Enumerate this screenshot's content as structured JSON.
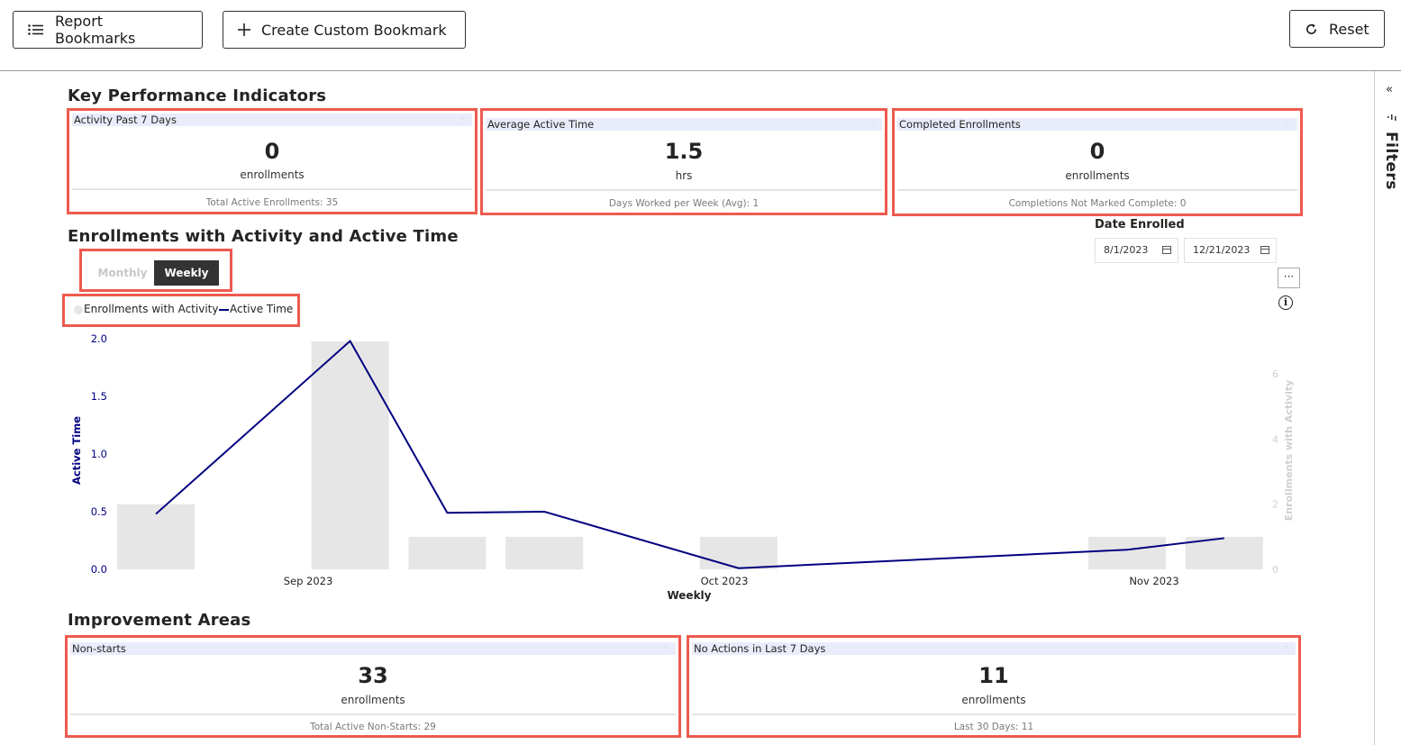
{
  "toolbar": {
    "report_bookmarks": "Report Bookmarks",
    "create_bookmark": "Create Custom Bookmark",
    "reset": "Reset"
  },
  "side_panel": {
    "label": "Filters"
  },
  "kpi_section": {
    "title": "Key Performance Indicators",
    "cards": [
      {
        "title": "Activity Past 7 Days",
        "value": "0",
        "unit": "enrollments",
        "footer": "Total Active Enrollments: 35"
      },
      {
        "title": "Average Active Time",
        "value": "1.5",
        "unit": "hrs",
        "footer": "Days Worked per Week (Avg): 1"
      },
      {
        "title": "Completed Enrollments",
        "value": "0",
        "unit": "enrollments",
        "footer": "Completions Not Marked Complete: 0"
      }
    ]
  },
  "activity_section": {
    "title": "Enrollments with Activity and Active Time",
    "toggle": {
      "options": [
        "Monthly",
        "Weekly"
      ],
      "selected": "Weekly"
    },
    "date_filter": {
      "label": "Date Enrolled",
      "start": "8/1/2023",
      "end": "12/21/2023"
    },
    "more_label": "···",
    "info_label": "i"
  },
  "colors": {
    "accent_highlight": "#ee5a4f",
    "line": "#000080",
    "bar": "#e6e6e6",
    "dark_toggle": "#333333"
  },
  "chart_data": {
    "type": "bar+line",
    "xlabel": "Weekly",
    "x_tick_labels": [
      "Sep 2023",
      "Oct 2023",
      "Nov 2023"
    ],
    "y_left": {
      "label": "Active Time",
      "ticks": [
        "0.0",
        "0.5",
        "1.0",
        "1.5",
        "2.0"
      ],
      "range": [
        0,
        2.0
      ]
    },
    "y_right": {
      "label": "Enrollments with Activity",
      "ticks": [
        "0",
        "2",
        "4",
        "6"
      ],
      "range": [
        0,
        7
      ]
    },
    "legend": {
      "placement": "top-left",
      "entries": [
        "Enrollments with Activity",
        "Active Time"
      ]
    },
    "weeks": [
      {
        "bar": 2,
        "line": 0.48
      },
      {
        "bar": 0,
        "line": null
      },
      {
        "bar": 7,
        "line": 1.98
      },
      {
        "bar": 1,
        "line": 0.49
      },
      {
        "bar": 1,
        "line": 0.5
      },
      {
        "bar": 0,
        "line": null
      },
      {
        "bar": 1,
        "line": 0.01
      },
      {
        "bar": 0,
        "line": null
      },
      {
        "bar": 0,
        "line": null
      },
      {
        "bar": 0,
        "line": null
      },
      {
        "bar": 1,
        "line": 0.17
      },
      {
        "bar": 1,
        "line": 0.27
      }
    ]
  },
  "improvement_section": {
    "title": "Improvement Areas",
    "cards": [
      {
        "title": "Non-starts",
        "value": "33",
        "unit": "enrollments",
        "footer": "Total Active Non-Starts: 29"
      },
      {
        "title": "No Actions in Last 7 Days",
        "value": "11",
        "unit": "enrollments",
        "footer": "Last 30 Days: 11"
      }
    ]
  }
}
